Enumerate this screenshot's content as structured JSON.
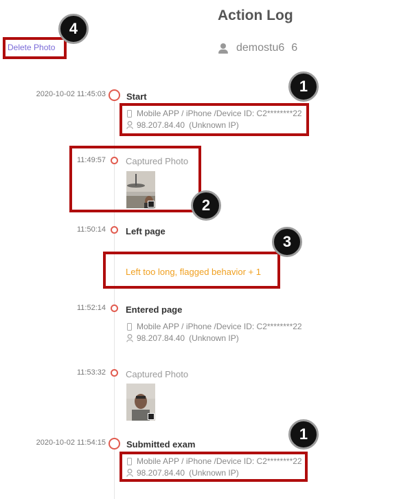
{
  "header": {
    "title": "Action Log",
    "username": "demostu6",
    "count": "6"
  },
  "toolbar": {
    "delete_photo_label": "Delete Photo"
  },
  "events": [
    {
      "time": "2020-10-02 11:45:03",
      "title": "Start",
      "device": "Mobile APP / iPhone /Device ID: C2********22",
      "ip": "98.207.84.40",
      "ip_note": "(Unknown IP)"
    },
    {
      "time": "11:49:57",
      "title": "Captured Photo"
    },
    {
      "time": "11:50:14",
      "title": "Left page",
      "flag": "Left too long, flagged behavior + 1"
    },
    {
      "time": "11:52:14",
      "title": "Entered page",
      "device": "Mobile APP / iPhone /Device ID: C2********22",
      "ip": "98.207.84.40",
      "ip_note": "(Unknown IP)"
    },
    {
      "time": "11:53:32",
      "title": "Captured Photo"
    },
    {
      "time": "2020-10-02 11:54:15",
      "title": "Submitted exam",
      "device": "Mobile APP / iPhone /Device ID: C2********22",
      "ip": "98.207.84.40",
      "ip_note": "(Unknown IP)"
    }
  ],
  "annotations": {
    "badge_1": "1",
    "badge_2": "2",
    "badge_3": "3",
    "badge_4": "4",
    "box_color": "#b00d0d"
  },
  "colors": {
    "accent_dot": "#e15b4f",
    "flag_text": "#f0a020",
    "link": "#7a6ad8"
  }
}
